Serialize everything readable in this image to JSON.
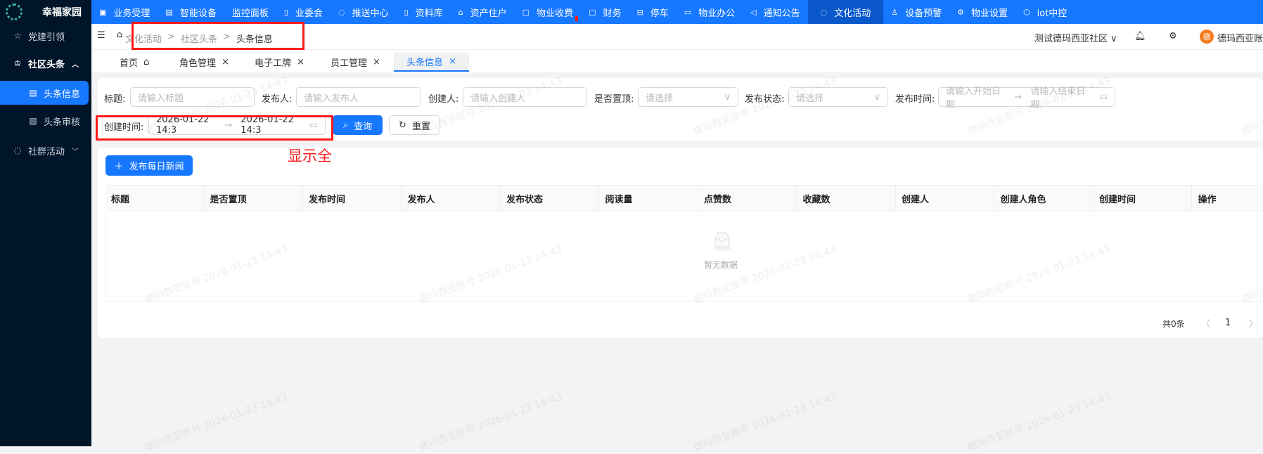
{
  "app": {
    "name": "幸福家园"
  },
  "sidebar": {
    "items": [
      {
        "label": "党建引领",
        "icon": "star-icon"
      },
      {
        "label": "社区头条",
        "icon": "crown-icon",
        "expanded": true
      },
      {
        "label": "头条信息",
        "icon": "list-icon",
        "active": true
      },
      {
        "label": "头条审核",
        "icon": "audit-icon"
      },
      {
        "label": "社群活动",
        "icon": "chat-icon"
      }
    ]
  },
  "topnav": {
    "items": [
      "业务受理",
      "智能设备",
      "监控面板",
      "业委会",
      "推送中心",
      "资料库",
      "资产住户",
      "物业收费",
      "财务",
      "停车",
      "物业办公",
      "通知公告",
      "文化活动",
      "设备预警",
      "物业设置",
      "iot中控"
    ],
    "active": "文化活动"
  },
  "breadcrumb": [
    "文化活动",
    "社区头条",
    "头条信息"
  ],
  "header": {
    "community": "测试德玛西亚社区",
    "avatar_char": "德",
    "user": "德玛西亚账"
  },
  "tabs": [
    "首页",
    "角色管理",
    "电子工牌",
    "员工管理",
    "头条信息"
  ],
  "filters": {
    "title": {
      "label": "标题:",
      "placeholder": "请输入标题"
    },
    "publisher": {
      "label": "发布人:",
      "placeholder": "请输入发布人"
    },
    "creator": {
      "label": "创建人:",
      "placeholder": "请输入创建人"
    },
    "pinned": {
      "label": "是否置顶:",
      "placeholder": "请选择"
    },
    "status": {
      "label": "发布状态:",
      "placeholder": "请选择"
    },
    "publish_time": {
      "label": "发布时间:",
      "start": "请输入开始日期",
      "end": "请输入结束日期"
    },
    "create_time": {
      "label": "创建时间:",
      "start": "2026-01-22 14:3",
      "end": "2026-01-22 14:3"
    },
    "query": "查询",
    "reset": "重置"
  },
  "annotation": "显示全",
  "actions": {
    "add": "发布每日新闻"
  },
  "table": {
    "columns": [
      "标题",
      "是否置顶",
      "发布时间",
      "发布人",
      "发布状态",
      "阅读量",
      "点赞数",
      "收藏数",
      "创建人",
      "创建人角色",
      "创建时间",
      "操作"
    ],
    "empty": "暂无数据"
  },
  "pagination": {
    "total": "共0条",
    "page": "1"
  },
  "watermark": "德玛西亚账号 2026-01-23 14:43",
  "colors": {
    "primary": "#1677ff",
    "sidebar": "#001529",
    "annotation": "#ff1a1a"
  }
}
